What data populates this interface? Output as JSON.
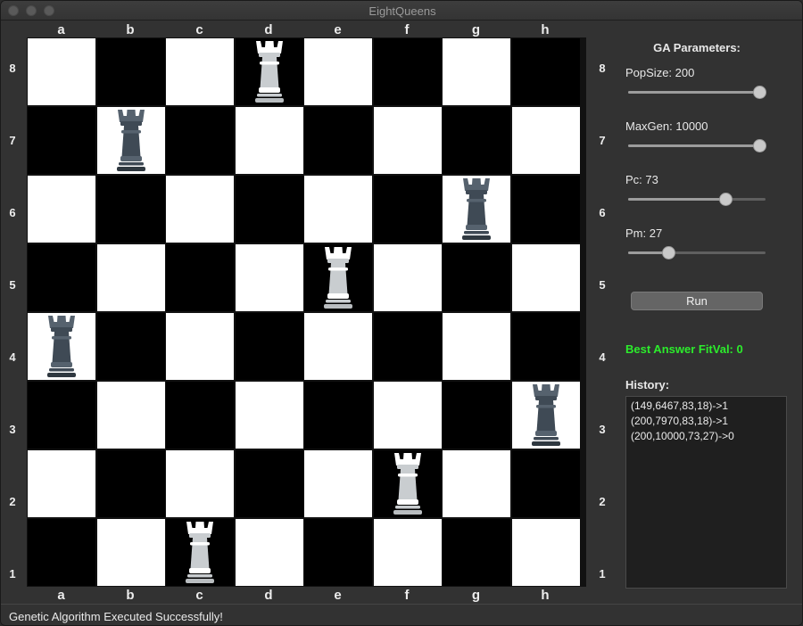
{
  "window": {
    "title": "EightQueens"
  },
  "board": {
    "files": [
      "a",
      "b",
      "c",
      "d",
      "e",
      "f",
      "g",
      "h"
    ],
    "ranks": [
      "8",
      "7",
      "6",
      "5",
      "4",
      "3",
      "2",
      "1"
    ],
    "light_color": "#ffffff",
    "dark_color": "#000000",
    "pieces": [
      {
        "file": "d",
        "rank": "8",
        "color": "white",
        "icon": "white-rook-icon"
      },
      {
        "file": "b",
        "rank": "7",
        "color": "dark",
        "icon": "dark-rook-icon"
      },
      {
        "file": "g",
        "rank": "6",
        "color": "dark",
        "icon": "dark-rook-icon"
      },
      {
        "file": "e",
        "rank": "5",
        "color": "white",
        "icon": "white-rook-icon"
      },
      {
        "file": "a",
        "rank": "4",
        "color": "dark",
        "icon": "dark-rook-icon"
      },
      {
        "file": "h",
        "rank": "3",
        "color": "dark",
        "icon": "dark-rook-icon"
      },
      {
        "file": "f",
        "rank": "2",
        "color": "white",
        "icon": "white-rook-icon"
      },
      {
        "file": "c",
        "rank": "1",
        "color": "white",
        "icon": "white-rook-icon"
      }
    ]
  },
  "panel": {
    "title": "GA Parameters:",
    "params": [
      {
        "label": "PopSize: 200",
        "level": 1.0
      },
      {
        "label": "MaxGen: 10000",
        "level": 1.0
      },
      {
        "label": "Pc: 73",
        "level": 0.73
      },
      {
        "label": "Pm: 27",
        "level": 0.27
      }
    ],
    "run_label": "Run",
    "best_answer": "Best Answer FitVal: 0",
    "best_color": "#2cec2c",
    "history_label": "History:",
    "history": [
      "(149,6467,83,18)->1",
      "(200,7970,83,18)->1",
      "(200,10000,73,27)->0"
    ]
  },
  "status": {
    "text": "Genetic Algorithm Executed Successfully!"
  }
}
